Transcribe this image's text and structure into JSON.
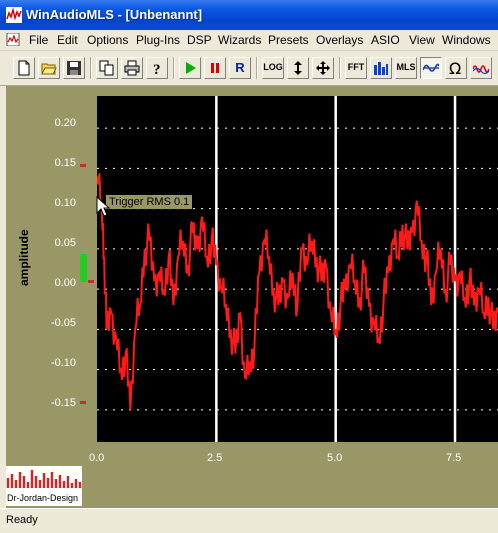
{
  "window": {
    "title": "WinAudioMLS - [Unbenannt]"
  },
  "menu": [
    "File",
    "Edit",
    "Options",
    "Plug-Ins",
    "DSP",
    "Wizards",
    "Presets",
    "Overlays",
    "ASIO",
    "View",
    "Windows"
  ],
  "toolbar": {
    "log_label": "LOG",
    "fft_label": "FFT",
    "mls_label": "MLS",
    "rec_label": "R"
  },
  "plot": {
    "y_ticks": [
      "0.20",
      "0.15",
      "0.10",
      "0.05",
      "0.00",
      "-0.05",
      "-0.10",
      "-0.15"
    ],
    "x_ticks": [
      "0.0",
      "2.5",
      "5.0",
      "7.5"
    ],
    "ylabel": "amplitude",
    "annotation": "Trigger RMS 0.1",
    "colors": {
      "trace": "#ff1a1a",
      "background": "#000000",
      "grid": "#ffffff",
      "level": "#22cc22"
    }
  },
  "chart_data": {
    "type": "line",
    "ylabel": "amplitude",
    "ylim": [
      -0.19,
      0.24
    ],
    "xlim": [
      0,
      8.4
    ],
    "x_ticks": [
      0,
      2.5,
      5.0,
      7.5
    ],
    "y_ticks": [
      0.2,
      0.15,
      0.1,
      0.05,
      0.0,
      -0.05,
      -0.1,
      -0.15
    ],
    "series": [
      {
        "values_x": [
          0.0,
          0.1,
          0.15,
          0.2,
          0.3,
          0.4,
          0.5,
          0.6,
          0.7,
          0.8,
          0.9,
          1.0,
          1.1,
          1.2,
          1.3,
          1.4,
          1.5,
          1.6,
          1.7,
          1.8,
          1.9,
          2.0,
          2.1,
          2.2,
          2.3,
          2.4,
          2.5,
          2.6,
          2.7,
          2.8,
          2.9,
          3.0,
          3.1,
          3.2,
          3.3,
          3.4,
          3.5,
          3.6,
          3.7,
          3.8,
          3.9,
          4.0,
          4.1,
          4.2,
          4.3,
          4.4,
          4.5,
          4.6,
          4.7,
          4.8,
          4.9,
          5.0,
          5.1,
          5.2,
          5.3,
          5.4,
          5.5,
          5.6,
          5.7,
          5.8,
          5.9,
          6.0,
          6.1,
          6.2,
          6.3,
          6.4,
          6.5,
          6.6,
          6.7,
          6.8,
          6.9,
          7.0,
          7.1,
          7.2,
          7.3,
          7.4,
          7.5,
          7.6,
          7.7,
          7.8,
          7.9,
          8.0,
          8.1,
          8.2,
          8.3,
          8.4
        ],
        "values": [
          0.14,
          0.1,
          0.04,
          -0.05,
          -0.03,
          -0.06,
          -0.1,
          -0.08,
          -0.15,
          -0.05,
          -0.02,
          0.05,
          0.06,
          0.01,
          0.02,
          0.0,
          0.04,
          -0.02,
          0.04,
          0.06,
          0.03,
          0.07,
          0.05,
          0.09,
          0.04,
          0.06,
          0.03,
          0.0,
          -0.02,
          -0.05,
          -0.08,
          -0.03,
          -0.11,
          -0.09,
          -0.07,
          0.02,
          0.06,
          0.04,
          0.0,
          -0.02,
          0.01,
          -0.01,
          0.02,
          -0.02,
          0.05,
          0.03,
          0.06,
          0.04,
          0.01,
          0.03,
          -0.03,
          -0.05,
          -0.02,
          0.0,
          0.03,
          0.01,
          -0.01,
          0.02,
          -0.02,
          -0.04,
          -0.06,
          -0.02,
          0.02,
          0.06,
          0.04,
          0.08,
          0.05,
          0.07,
          0.11,
          0.06,
          0.04,
          -0.02,
          0.02,
          0.05,
          0.0,
          0.03,
          0.01,
          0.02,
          -0.01,
          0.01,
          -0.02,
          0.0,
          -0.03,
          -0.01,
          -0.05,
          -0.03
        ]
      }
    ]
  },
  "status": {
    "text": "Ready"
  },
  "logo": {
    "text": "Dr-Jordan-Design"
  }
}
